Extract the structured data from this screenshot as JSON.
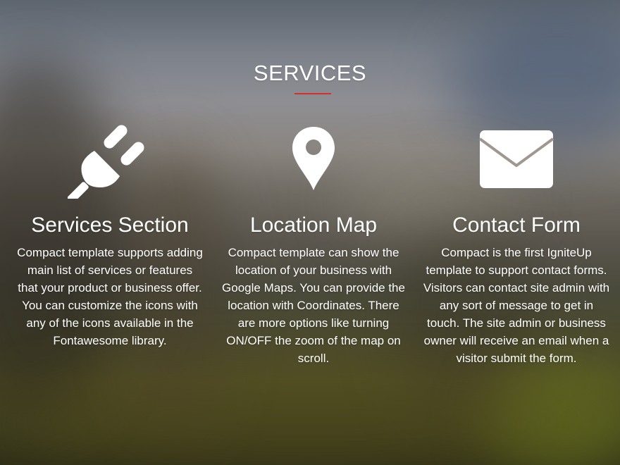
{
  "section": {
    "title": "SERVICES",
    "accent_color": "#d32f2f"
  },
  "services": [
    {
      "icon": "plug-icon",
      "title": "Services Section",
      "description": "Compact template supports adding main list of services or features that your product or business offer. You can customize the icons with any of the icons available in the Fontawesome library."
    },
    {
      "icon": "map-marker-icon",
      "title": "Location Map",
      "description": "Compact template can show the location of your business with Google Maps. You can provide the location with Coordinates. There are more options like turning ON/OFF the zoom of the map on scroll."
    },
    {
      "icon": "envelope-icon",
      "title": "Contact Form",
      "description": "Compact is the first IgniteUp template to support contact forms. Visitors can contact site admin with any sort of message to get in touch. The site admin or business owner will receive an email when a visitor submit the form."
    }
  ]
}
